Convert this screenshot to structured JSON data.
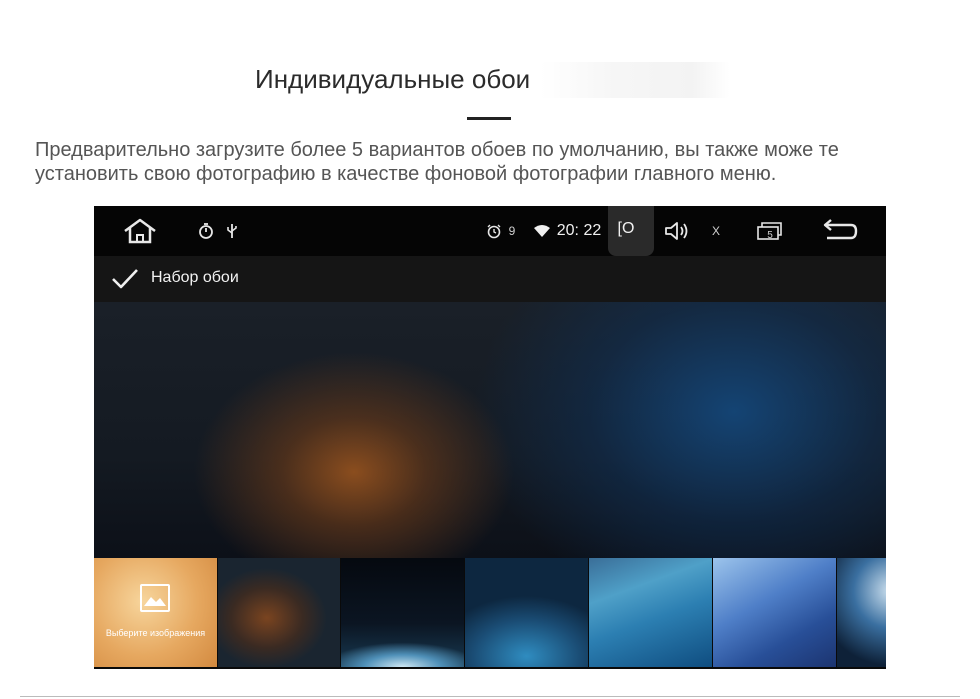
{
  "heading": {
    "title": "Индивидуальные обои"
  },
  "description": "Предварительно загрузите более 5 вариантов обоев по умолчанию, вы также може те установить свою фотографию в качестве фоновой фотографии главного меню.",
  "statusbar": {
    "alarm_count": "9",
    "clock": "20: 22",
    "camera_label": "[O",
    "close_label": "X",
    "multiwindow_count": "5"
  },
  "toolbar": {
    "title": "Набор обои"
  },
  "thumbnails": {
    "select_label": "Выберите изображения"
  },
  "colors": {
    "statusbar_bg": "#050505",
    "toolbar_bg": "#151515",
    "accent_warm": "#91501e",
    "accent_cool": "#14467a"
  },
  "icons": {
    "home": "home-icon",
    "timer": "stopwatch-icon",
    "usb": "usb-icon",
    "alarm": "alarm-icon",
    "wifi": "wifi-icon",
    "volume": "volume-icon",
    "multiwindow": "multiwindow-icon",
    "back": "back-arrow-icon",
    "confirm": "checkmark-icon",
    "picture": "image-icon"
  }
}
